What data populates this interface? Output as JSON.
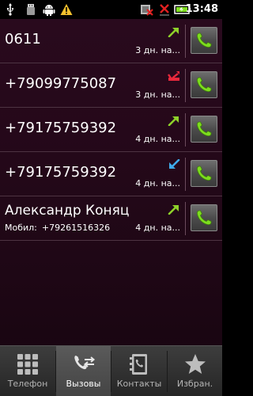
{
  "status_bar": {
    "time": "13:48",
    "icons": [
      "usb-icon",
      "android-icon",
      "warning-icon",
      "no-sim-icon",
      "no-signal-icon",
      "battery-icon"
    ]
  },
  "colors": {
    "outgoing": "#8ed12a",
    "missed": "#e8283c",
    "incoming": "#3fa9e8",
    "call_button_handset": "#7ddc1f"
  },
  "calls": [
    {
      "name": "0611",
      "type": "outgoing",
      "time": "3 дн. на..."
    },
    {
      "name": "+79099775087",
      "type": "missed",
      "time": "3 дн. на..."
    },
    {
      "name": "+79175759392",
      "type": "outgoing",
      "time": "4 дн. на..."
    },
    {
      "name": "+79175759392",
      "type": "incoming",
      "time": "4 дн. на..."
    },
    {
      "name": "Александр Коняц",
      "type": "outgoing",
      "sub_label": "Мобил:",
      "sub_number": "+79261516326",
      "time": "4 дн. на..."
    }
  ],
  "tabs": [
    {
      "label": "Телефон",
      "icon": "dialpad-icon",
      "active": false
    },
    {
      "label": "Вызовы",
      "icon": "call-log-icon",
      "active": true
    },
    {
      "label": "Контакты",
      "icon": "contacts-icon",
      "active": false
    },
    {
      "label": "Избран.",
      "icon": "star-icon",
      "active": false
    }
  ]
}
